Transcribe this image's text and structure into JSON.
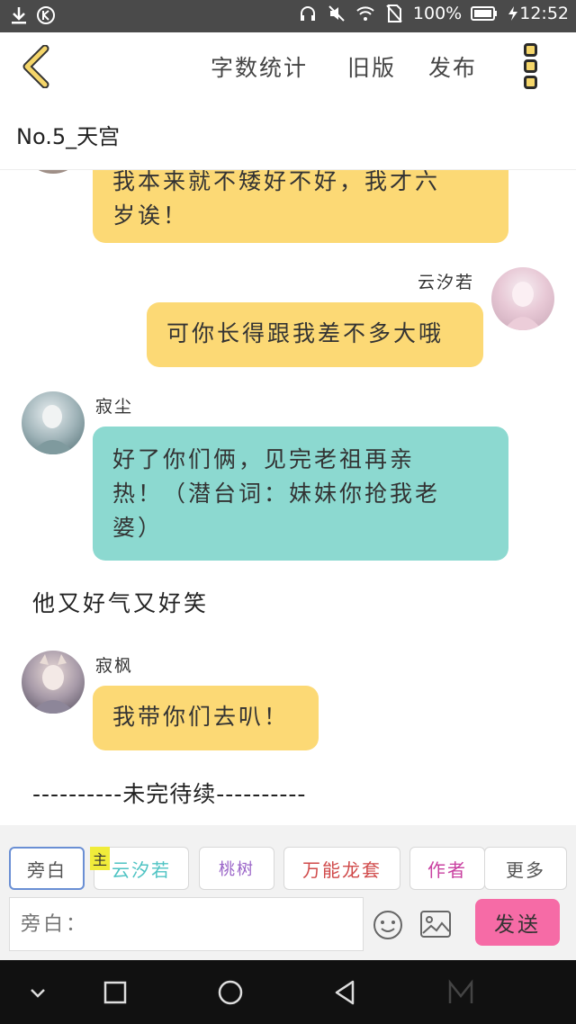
{
  "status_bar": {
    "battery": "100%",
    "time": "12:52",
    "icons": [
      "download-icon",
      "k-badge-icon",
      "headphones-icon",
      "mute-icon",
      "wifi-icon",
      "no-sim-icon",
      "battery-icon",
      "charging-icon"
    ]
  },
  "toolbar": {
    "word_count_label": "字数统计",
    "old_version_label": "旧版",
    "publish_label": "发布"
  },
  "chapter_title": "No.5_天宫",
  "messages": [
    {
      "type": "bubble",
      "side": "left",
      "color": "#fcd975",
      "text_line1": "我本来就不矮好不好，我才六",
      "text_line2": "岁诶！"
    },
    {
      "type": "bubble",
      "side": "right",
      "speaker": "云汐若",
      "color": "#fcd975",
      "text": "可你长得跟我差不多大哦"
    },
    {
      "type": "bubble",
      "side": "left",
      "speaker": "寂尘",
      "color": "#8cd9d0",
      "text_line1": "好了你们俩，见完老祖再亲",
      "text_line2": "热！（潜台词：妹妹你抢我老",
      "text_line3": "婆）"
    },
    {
      "type": "narration",
      "text": "他又好气又好笑"
    },
    {
      "type": "bubble",
      "side": "left",
      "speaker": "寂枫",
      "color": "#fcd975",
      "text": "我带你们去叭！"
    },
    {
      "type": "narration",
      "text": "----------未完待续----------"
    }
  ],
  "roles": {
    "narrator": "旁白",
    "host_badge": "主",
    "yunxiruo": "云汐若",
    "taoshu": "桃树",
    "wanneng": "万能龙套",
    "author": "作者",
    "more": "更多"
  },
  "input": {
    "placeholder": "旁白："
  },
  "send_label": "发送",
  "colors": {
    "yellow_bubble": "#fcd975",
    "teal_bubble": "#8cd9d0",
    "send_button": "#f66ba6",
    "selected_role_border": "#6a8fd4"
  }
}
